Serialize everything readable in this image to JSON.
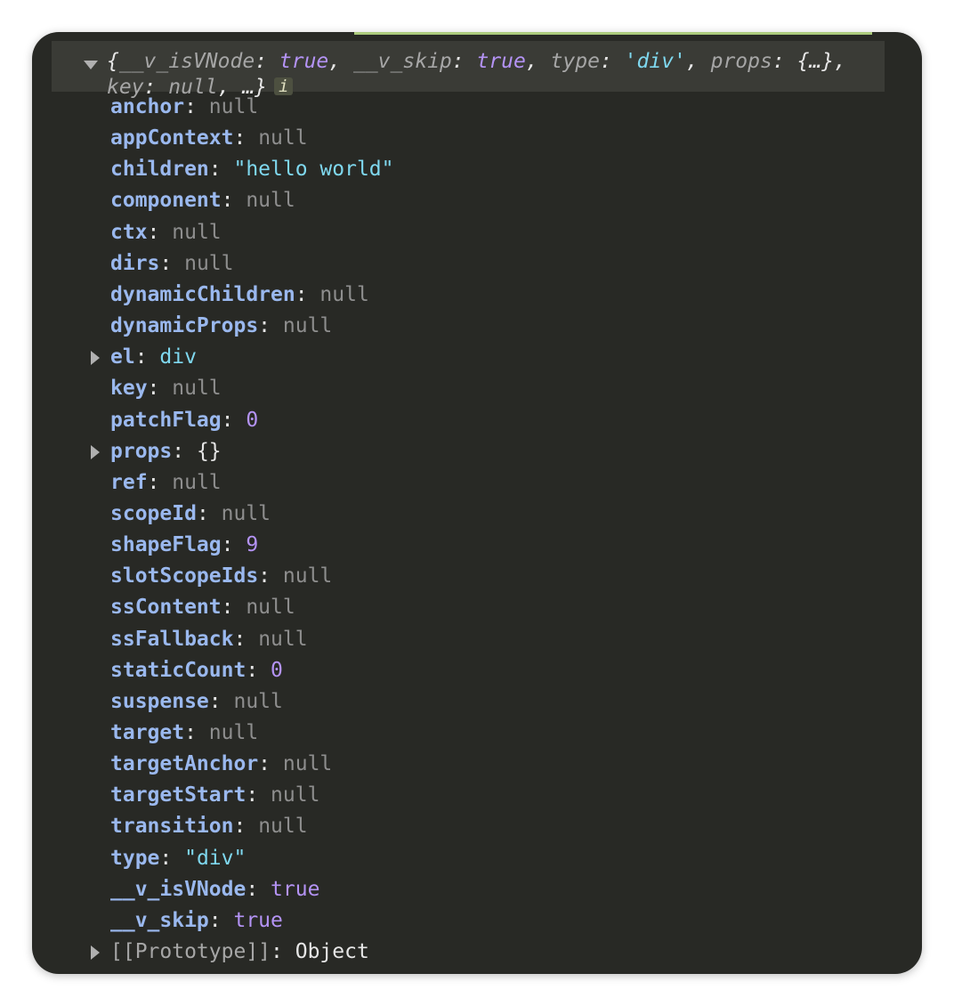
{
  "summary": {
    "line1": [
      {
        "t": "{",
        "c": "plain"
      },
      {
        "t": "__v_isVNode",
        "c": "k"
      },
      {
        "t": ": ",
        "c": "plain"
      },
      {
        "t": "true",
        "c": "bool"
      },
      {
        "t": ", ",
        "c": "plain"
      },
      {
        "t": "__v_skip",
        "c": "k"
      },
      {
        "t": ": ",
        "c": "plain"
      },
      {
        "t": "true",
        "c": "bool"
      },
      {
        "t": ", ",
        "c": "plain"
      },
      {
        "t": "type",
        "c": "k"
      },
      {
        "t": ": ",
        "c": "plain"
      },
      {
        "t": "'div'",
        "c": "str"
      },
      {
        "t": ", ",
        "c": "plain"
      },
      {
        "t": "props",
        "c": "k"
      },
      {
        "t": ": ",
        "c": "plain"
      },
      {
        "t": "{…}",
        "c": "plain"
      },
      {
        "t": ",",
        "c": "plain"
      }
    ],
    "line2": [
      {
        "t": "key",
        "c": "k"
      },
      {
        "t": ": ",
        "c": "plain"
      },
      {
        "t": "null",
        "c": "k"
      },
      {
        "t": ", …}",
        "c": "plain"
      }
    ],
    "badge": "i"
  },
  "properties": [
    {
      "key": "anchor",
      "value": "null",
      "type": "nul",
      "expandable": false
    },
    {
      "key": "appContext",
      "value": "null",
      "type": "nul",
      "expandable": false
    },
    {
      "key": "children",
      "value": "\"hello world\"",
      "type": "str",
      "expandable": false
    },
    {
      "key": "component",
      "value": "null",
      "type": "nul",
      "expandable": false
    },
    {
      "key": "ctx",
      "value": "null",
      "type": "nul",
      "expandable": false
    },
    {
      "key": "dirs",
      "value": "null",
      "type": "nul",
      "expandable": false
    },
    {
      "key": "dynamicChildren",
      "value": "null",
      "type": "nul",
      "expandable": false
    },
    {
      "key": "dynamicProps",
      "value": "null",
      "type": "nul",
      "expandable": false
    },
    {
      "key": "el",
      "value": "div",
      "type": "str",
      "expandable": true
    },
    {
      "key": "key",
      "value": "null",
      "type": "nul",
      "expandable": false
    },
    {
      "key": "patchFlag",
      "value": "0",
      "type": "num",
      "expandable": false
    },
    {
      "key": "props",
      "value": "{}",
      "type": "plain",
      "expandable": true
    },
    {
      "key": "ref",
      "value": "null",
      "type": "nul",
      "expandable": false
    },
    {
      "key": "scopeId",
      "value": "null",
      "type": "nul",
      "expandable": false
    },
    {
      "key": "shapeFlag",
      "value": "9",
      "type": "num",
      "expandable": false
    },
    {
      "key": "slotScopeIds",
      "value": "null",
      "type": "nul",
      "expandable": false
    },
    {
      "key": "ssContent",
      "value": "null",
      "type": "nul",
      "expandable": false
    },
    {
      "key": "ssFallback",
      "value": "null",
      "type": "nul",
      "expandable": false
    },
    {
      "key": "staticCount",
      "value": "0",
      "type": "num",
      "expandable": false
    },
    {
      "key": "suspense",
      "value": "null",
      "type": "nul",
      "expandable": false
    },
    {
      "key": "target",
      "value": "null",
      "type": "nul",
      "expandable": false
    },
    {
      "key": "targetAnchor",
      "value": "null",
      "type": "nul",
      "expandable": false
    },
    {
      "key": "targetStart",
      "value": "null",
      "type": "nul",
      "expandable": false
    },
    {
      "key": "transition",
      "value": "null",
      "type": "nul",
      "expandable": false
    },
    {
      "key": "type",
      "value": "\"div\"",
      "type": "str",
      "expandable": false
    },
    {
      "key": "__v_isVNode",
      "value": "true",
      "type": "bool",
      "expandable": false
    },
    {
      "key": "__v_skip",
      "value": "true",
      "type": "bool",
      "expandable": false
    },
    {
      "key": "[[Prototype]]",
      "value": "Object",
      "type": "plain",
      "expandable": true,
      "proto": true
    }
  ]
}
